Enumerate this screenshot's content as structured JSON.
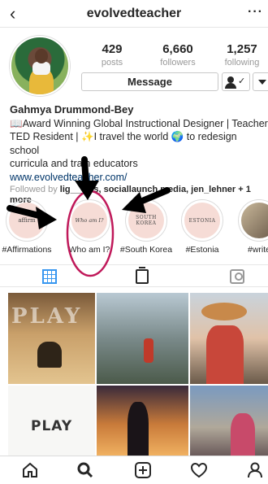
{
  "header": {
    "username": "evolvedteacher"
  },
  "stats": [
    {
      "num": "429",
      "label": "posts"
    },
    {
      "num": "6,660",
      "label": "followers"
    },
    {
      "num": "1,257",
      "label": "following"
    }
  ],
  "buttons": {
    "message": "Message"
  },
  "bio": {
    "name": "Gahmya Drummond-Bey",
    "line1": "📖Award Winning Global Instructional Designer | Teacher",
    "line2": "TED Resident | ✨I travel the world 🌍 to redesign school",
    "line3": "curricula and train educators",
    "website": "www.evolvedteacher.com/",
    "followed_prefix": "Followed by",
    "followed_names": "lig___ers, sociallaunch.media, jen_lehner",
    "followed_suffix": "+ 1",
    "more": "more"
  },
  "highlights": [
    {
      "label": "#Affirmations",
      "disc": "affirm"
    },
    {
      "label": "Who am I?",
      "disc": "Who am I?"
    },
    {
      "label": "#South Korea",
      "disc": "SOUTH KOREA"
    },
    {
      "label": "#Estonia",
      "disc": "ESTONIA"
    },
    {
      "label": "#write",
      "disc": ""
    }
  ],
  "photos": {
    "play_text": "PLAY"
  },
  "colors": {
    "accent": "#3897f0",
    "annotation": "#c0195a"
  }
}
